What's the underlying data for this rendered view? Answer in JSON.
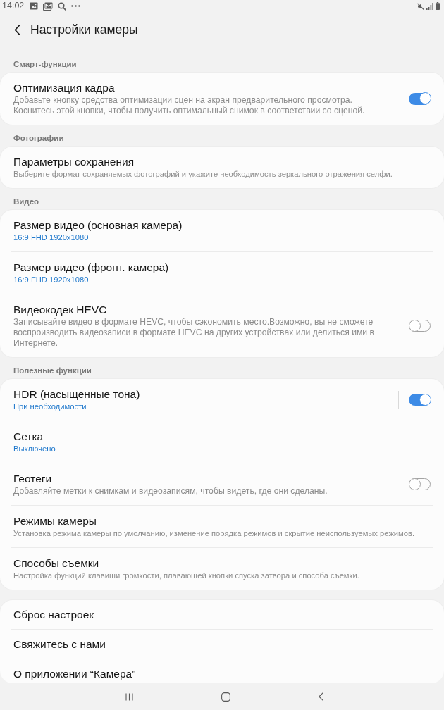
{
  "status_bar": {
    "time": "14:02"
  },
  "header": {
    "title": "Настройки камеры"
  },
  "sections": [
    {
      "title": "Смарт-функции",
      "items": [
        {
          "kind": "switch",
          "title": "Оптимизация кадра",
          "description": "Добавьте кнопку средства оптимизации сцен на экран предварительного просмотра. Коснитесь этой кнопки, чтобы получить оптимальный снимок в соответствии со сценой.",
          "on": true
        }
      ]
    },
    {
      "title": "Фотографии",
      "items": [
        {
          "kind": "plain",
          "title": "Параметры сохранения",
          "description": "Выберите формат сохраняемых фотографий и укажите необходимость зеркального отражения селфи."
        }
      ]
    },
    {
      "title": "Видео",
      "items": [
        {
          "kind": "plain",
          "title": "Размер видео (основная камера)",
          "value": "16:9 FHD 1920x1080"
        },
        {
          "kind": "plain",
          "title": "Размер видео (фронт. камера)",
          "value": "16:9 FHD 1920x1080"
        },
        {
          "kind": "switch",
          "title": "Видеокодек HEVC",
          "description": "Записывайте видео в формате HEVC, чтобы сэкономить место.Возможно, вы не сможете воспроизводить видеозаписи в формате HEVC на других устройствах или делиться ими в Интернете.",
          "on": false
        }
      ]
    },
    {
      "title": "Полезные функции",
      "items": [
        {
          "kind": "split_switch",
          "title": "HDR (насыщенные тона)",
          "value": "При необходимости",
          "on": true
        },
        {
          "kind": "plain",
          "title": "Сетка",
          "value": "Выключено"
        },
        {
          "kind": "switch",
          "title": "Геотеги",
          "description": "Добавляйте метки к снимкам и видеозаписям, чтобы видеть, где они сделаны.",
          "on": false
        },
        {
          "kind": "plain",
          "title": "Режимы камеры",
          "description": "Установка режима камеры по умолчанию, изменение порядка режимов и скрытие неиспользуемых режимов."
        },
        {
          "kind": "plain",
          "title": "Способы съемки",
          "description": "Настройка функций клавиши громкости, плавающей кнопки спуска затвора и способа съемки."
        }
      ]
    },
    {
      "items": [
        {
          "kind": "plain",
          "title": "Сброс настроек"
        },
        {
          "kind": "plain",
          "title": "Свяжитесь с нами"
        },
        {
          "kind": "plain",
          "title": "О приложении “Камера”"
        }
      ]
    }
  ]
}
